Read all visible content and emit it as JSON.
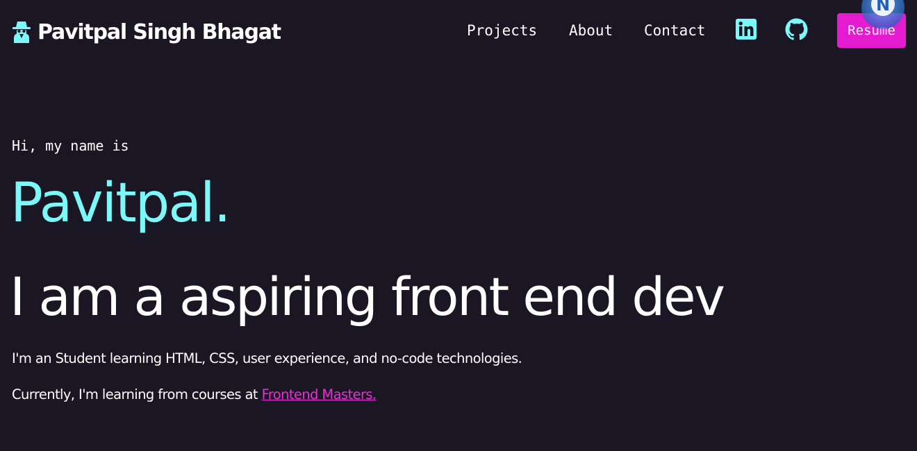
{
  "header": {
    "brand_name": "Pavitpal Singh Bhagat",
    "brand_icon": "spy-icon",
    "nav": [
      {
        "label": "Projects"
      },
      {
        "label": "About"
      },
      {
        "label": "Contact"
      }
    ],
    "social": [
      {
        "icon": "linkedin-icon"
      },
      {
        "icon": "github-icon"
      }
    ],
    "resume_label": "Resume",
    "badge_letter": "N"
  },
  "hero": {
    "greeting": "Hi, my name is",
    "name": "Pavitpal.",
    "tagline": "I am a aspiring front end dev",
    "intro": "I'm an Student learning HTML, CSS, user experience, and no-code technologies.",
    "learning_prefix": "Currently, I'm learning from courses at ",
    "learning_link": "Frontend Masters."
  },
  "colors": {
    "background": "#1a1623",
    "accent_cyan": "#7cf8f8",
    "accent_magenta": "#e51bd0",
    "text": "#ffffff"
  }
}
